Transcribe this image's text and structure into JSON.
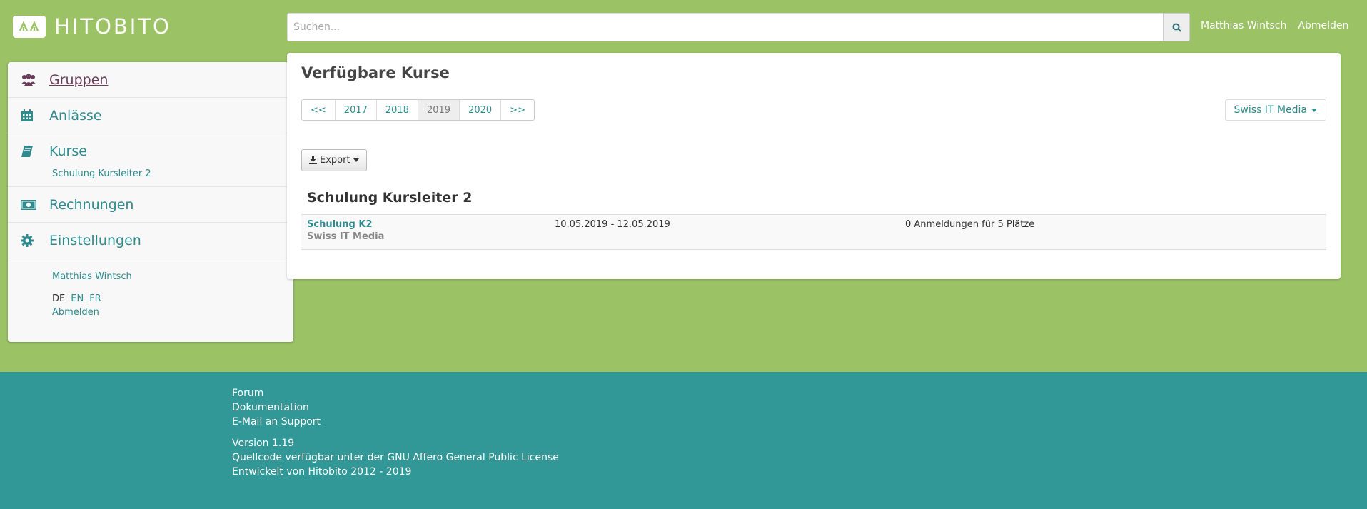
{
  "header": {
    "logo_text": "HITOBITO",
    "search_placeholder": "Suchen...",
    "user_name": "Matthias Wintsch",
    "logout": "Abmelden"
  },
  "sidebar": {
    "items": [
      {
        "label": "Gruppen",
        "icon": "users-icon"
      },
      {
        "label": "Anlässe",
        "icon": "calendar-icon"
      },
      {
        "label": "Kurse",
        "icon": "book-icon",
        "sub": "Schulung Kursleiter 2"
      },
      {
        "label": "Rechnungen",
        "icon": "money-icon"
      },
      {
        "label": "Einstellungen",
        "icon": "gear-icon"
      }
    ],
    "user": "Matthias Wintsch",
    "languages": [
      "DE",
      "EN",
      "FR"
    ],
    "logout": "Abmelden"
  },
  "main": {
    "title": "Verfügbare Kurse",
    "pager": [
      "<<",
      "2017",
      "2018",
      "2019",
      "2020",
      ">>"
    ],
    "pager_current": "2019",
    "org_filter": "Swiss IT Media",
    "export_label": "Export",
    "group_title": "Schulung Kursleiter 2",
    "courses": [
      {
        "name": "Schulung K2",
        "organizer": "Swiss IT Media",
        "dates": "10.05.2019 - 12.05.2019",
        "registrations": "0 Anmeldungen für 5 Plätze"
      }
    ]
  },
  "footer": {
    "links": [
      "Forum",
      "Dokumentation",
      "E-Mail an Support"
    ],
    "version": "Version 1.19",
    "license": "Quellcode verfügbar unter der GNU Affero General Public License",
    "developed": "Entwickelt von Hitobito 2012 - 2019"
  },
  "colors": {
    "background": "#9bc265",
    "accent": "#2f8b8d",
    "footer": "#319797",
    "active_nav": "#6a3e5b"
  }
}
